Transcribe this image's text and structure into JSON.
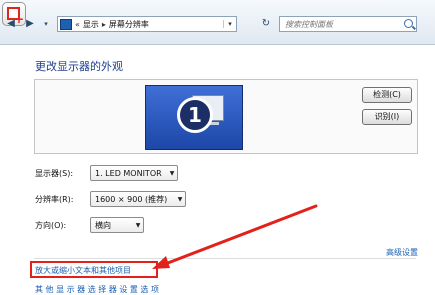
{
  "toolbar": {
    "address_segments": [
      "显示",
      "屏幕分辨率"
    ],
    "search_placeholder": "搜索控制面板"
  },
  "page": {
    "title": "更改显示器的外观",
    "monitor_number": "1",
    "detect_button": "检测(C)",
    "identify_button": "识别(I)"
  },
  "form": {
    "display_label": "显示器(S):",
    "display_value": "1. LED MONITOR",
    "resolution_label": "分辨率(R):",
    "resolution_value": "1600 × 900 (推荐)",
    "orientation_label": "方向(O):",
    "orientation_value": "横向"
  },
  "links": {
    "advanced": "高级设置",
    "zoom_text": "放大或缩小文本和其他项目",
    "cut_off_text": "其 他 显 示 器 选 择 器 设 置 选 项"
  },
  "colors": {
    "annotation": "#e2211a",
    "link": "#1a5fb4",
    "title": "#1e3f8c"
  }
}
